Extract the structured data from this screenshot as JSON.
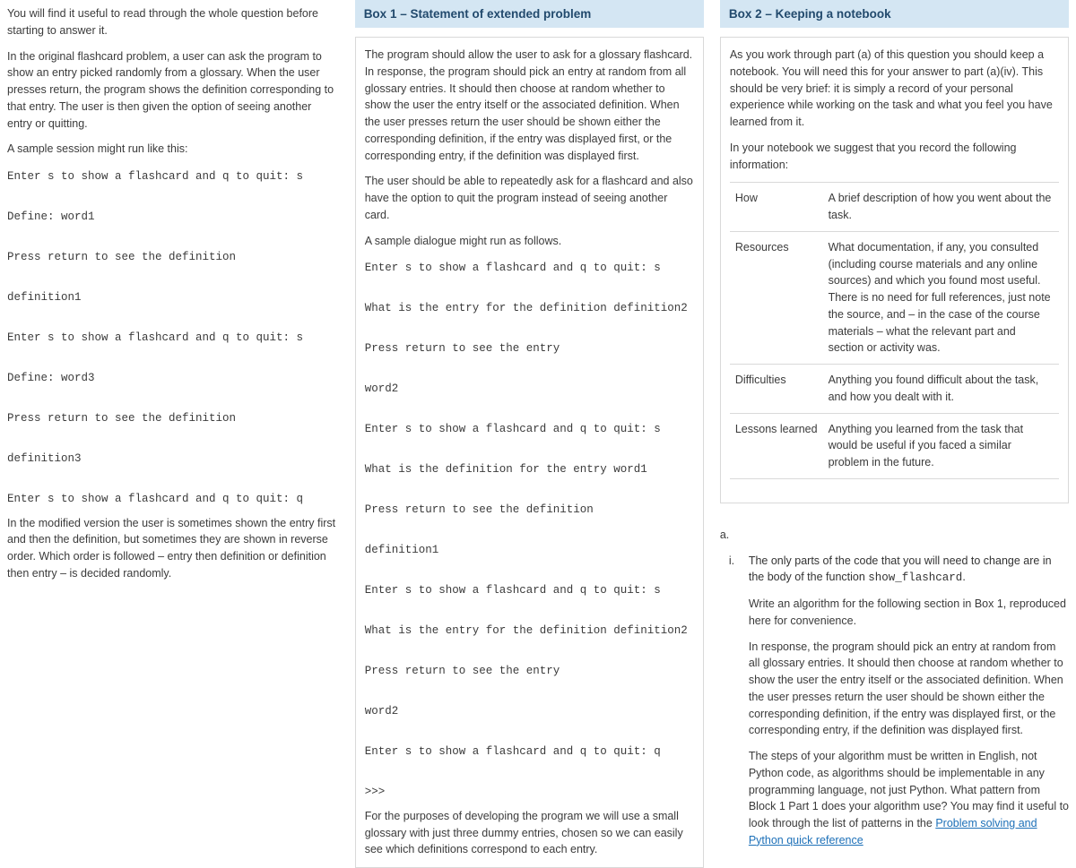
{
  "left": {
    "p1": "You will find it useful to read through the whole question before starting to answer it.",
    "p2": "In the original flashcard problem, a user can ask the program to show an entry picked randomly from a glossary. When the user presses return, the program shows the definition corresponding to that entry. The user is then given the option of seeing another entry or quitting.",
    "p3": "A sample session might run like this:",
    "code": "Enter s to show a flashcard and q to quit: s\n\nDefine: word1\n\nPress return to see the definition\n\ndefinition1\n\nEnter s to show a flashcard and q to quit: s\n\nDefine: word3\n\nPress return to see the definition\n\ndefinition3\n\nEnter s to show a flashcard and q to quit: q",
    "p4": "In the modified version the user is sometimes shown the entry first and then the definition, but sometimes they are shown in reverse order. Which order is followed – entry then definition or definition then entry – is decided randomly."
  },
  "box1": {
    "title": "Box 1 – Statement of extended problem",
    "p1": "The program should allow the user to ask for a glossary flashcard. In response, the program should pick an entry at random from all glossary entries. It should then choose at random whether to show the user the entry itself or the associated definition. When the user presses return the user should be shown either the corresponding definition, if the entry was displayed first, or the corresponding entry, if the definition was displayed first.",
    "p2": "The user should be able to repeatedly ask for a flashcard and also have the option to quit the program instead of seeing another card.",
    "p3": "A sample dialogue might run as follows.",
    "code": "Enter s to show a flashcard and q to quit: s\n\nWhat is the entry for the definition definition2\n\nPress return to see the entry\n\nword2\n\nEnter s to show a flashcard and q to quit: s\n\nWhat is the definition for the entry word1\n\nPress return to see the definition\n\ndefinition1\n\nEnter s to show a flashcard and q to quit: s\n\nWhat is the entry for the definition definition2\n\nPress return to see the entry\n\nword2\n\nEnter s to show a flashcard and q to quit: q\n\n>>>",
    "p4": "For the purposes of developing the program we will use a small glossary with just three dummy entries, chosen so we can easily see which definitions correspond to each entry."
  },
  "box2": {
    "title": "Box 2 – Keeping a notebook",
    "p1": "As you work through part (a) of this question you should keep a notebook. You will need this for your answer to part (a)(iv). This should be very brief: it is simply a record of your personal experience while working on the task and what you feel you have learned from it.",
    "p2": "In your notebook we suggest that you record the following information:",
    "rows": [
      {
        "k": "How",
        "v": "A brief description of how you went about the task."
      },
      {
        "k": "Resources",
        "v": "What documentation, if any, you consulted (including course materials and any online sources) and which you found most useful. There is no need for full references, just note the source, and – in the case of the course materials – what the relevant part and section or activity was."
      },
      {
        "k": "Difficulties",
        "v": "Anything you found difficult about the task, and how you dealt with it."
      },
      {
        "k": "Lessons learned",
        "v": "Anything you learned from the task that would be useful if you faced a similar problem in the future."
      }
    ]
  },
  "qa": {
    "marker": "a.",
    "i_rn": "i.",
    "i_1a": "The only parts of the code that you will need to change are in the body of the function ",
    "i_fn": "show_flashcard",
    "i_1b": ".",
    "i_2": "Write an algorithm for the following section in Box 1, reproduced here for convenience.",
    "i_3": "In response, the program should pick an entry at random from all glossary entries. It should then choose at random whether to show the user the entry itself or the associated definition. When the user presses return the user should be shown either the corresponding definition, if the entry was displayed first, or the corresponding entry, if the definition was displayed first.",
    "i_4a": "The steps of your algorithm must be written in English, not Python code, as algorithms should be implementable in any programming language, not just Python. What pattern from Block 1 Part 1 does your algorithm use? You may find it useful to look through the list of patterns in the ",
    "i_link": "Problem solving and Python quick reference"
  }
}
